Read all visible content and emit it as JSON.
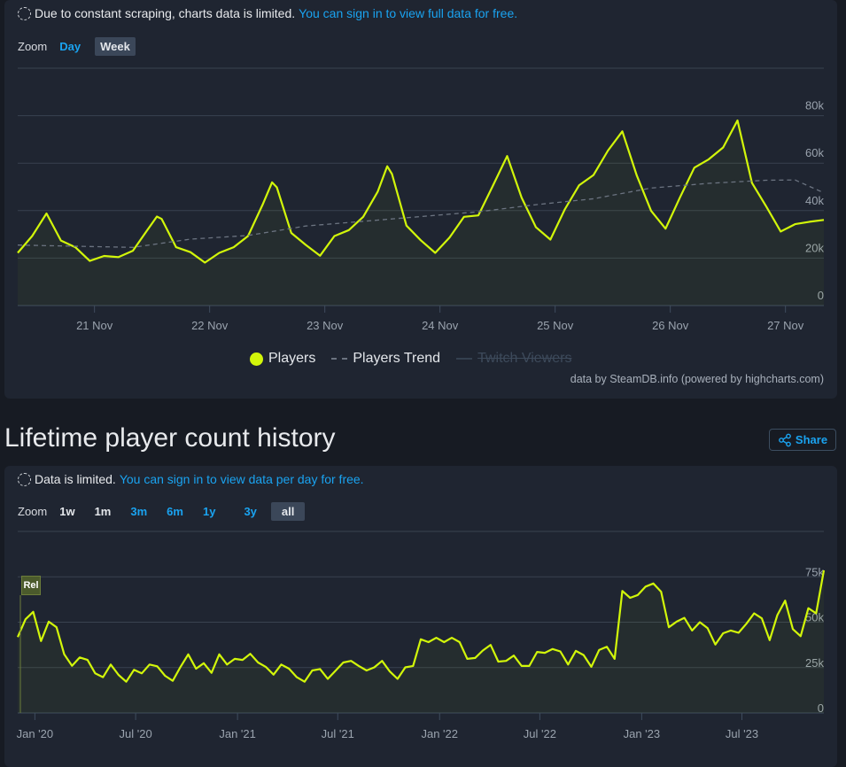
{
  "recent_panel": {
    "notice_text": "Due to constant scraping, charts data is limited.",
    "notice_link": "You can sign in to view full data for free.",
    "zoom_label": "Zoom",
    "zoom_options": [
      "Day",
      "Week"
    ],
    "zoom_selected": "Week",
    "legend": {
      "players": "Players",
      "trend": "Players Trend",
      "twitch": "Twitch Viewers"
    },
    "credit": "data by SteamDB.info (powered by highcharts.com)"
  },
  "lifetime_section": {
    "title": "Lifetime player count history",
    "share_label": "Share",
    "notice_text": "Data is limited.",
    "notice_link": "You can sign in to view data per day for free.",
    "zoom_label": "Zoom",
    "zoom_options": [
      "1w",
      "1m",
      "3m",
      "6m",
      "1y",
      "3y",
      "all"
    ],
    "zoom_selected": "all",
    "flag_label": "Rel"
  },
  "colors": {
    "players": "#d2f60a",
    "trend": "#6b7380",
    "twitch_disabled": "#3d4a5b",
    "link": "#1aa3f0",
    "background": "#171b23",
    "panel": "#1f2531"
  },
  "chart_data": [
    {
      "type": "line",
      "xlabel": "",
      "ylabel": "",
      "x_ticks": [
        "21 Nov",
        "22 Nov",
        "23 Nov",
        "24 Nov",
        "25 Nov",
        "26 Nov",
        "27 Nov"
      ],
      "y_ticks": [
        "0",
        "20k",
        "40k",
        "60k",
        "80k"
      ],
      "ylim": [
        0,
        100000
      ],
      "grid": true,
      "legend_position": "bottom",
      "series": [
        {
          "name": "Players",
          "style": "solid",
          "x": [
            "20 Nov 08:00",
            "20 Nov 11:00",
            "20 Nov 14:00",
            "20 Nov 17:00",
            "20 Nov 20:00",
            "20 Nov 23:00",
            "21 Nov 02:00",
            "21 Nov 05:00",
            "21 Nov 08:00",
            "21 Nov 11:00",
            "21 Nov 13:00",
            "21 Nov 14:00",
            "21 Nov 17:00",
            "21 Nov 20:00",
            "21 Nov 23:00",
            "22 Nov 02:00",
            "22 Nov 05:00",
            "22 Nov 08:00",
            "22 Nov 11:00",
            "22 Nov 13:00",
            "22 Nov 14:00",
            "22 Nov 17:00",
            "22 Nov 20:00",
            "22 Nov 23:00",
            "23 Nov 02:00",
            "23 Nov 05:00",
            "23 Nov 08:00",
            "23 Nov 11:00",
            "23 Nov 13:00",
            "23 Nov 14:00",
            "23 Nov 17:00",
            "23 Nov 20:00",
            "23 Nov 23:00",
            "24 Nov 02:00",
            "24 Nov 05:00",
            "24 Nov 08:00",
            "24 Nov 11:00",
            "24 Nov 14:00",
            "24 Nov 17:00",
            "24 Nov 20:00",
            "24 Nov 23:00",
            "25 Nov 02:00",
            "25 Nov 05:00",
            "25 Nov 08:00",
            "25 Nov 11:00",
            "25 Nov 14:00",
            "25 Nov 17:00",
            "25 Nov 20:00",
            "25 Nov 23:00",
            "26 Nov 02:00",
            "26 Nov 05:00",
            "26 Nov 08:00",
            "26 Nov 11:00",
            "26 Nov 14:00",
            "26 Nov 17:00",
            "26 Nov 20:00",
            "26 Nov 23:00",
            "27 Nov 02:00",
            "27 Nov 05:00",
            "27 Nov 08:00"
          ],
          "y": [
            22200,
            29300,
            38800,
            27400,
            24600,
            18800,
            20900,
            20400,
            23100,
            31800,
            37500,
            36500,
            24600,
            22500,
            18100,
            22200,
            24600,
            29300,
            42400,
            51900,
            49800,
            30600,
            25600,
            21000,
            29300,
            31800,
            37400,
            47900,
            58700,
            55400,
            33700,
            27500,
            22200,
            28700,
            37400,
            38000,
            50400,
            63000,
            45500,
            33000,
            27800,
            40500,
            50700,
            55000,
            65300,
            73400,
            54800,
            39900,
            32400,
            45500,
            58100,
            61600,
            66600,
            78000,
            51700,
            41700,
            31200,
            34300,
            35300,
            36100
          ]
        },
        {
          "name": "Players Trend",
          "style": "dashed",
          "x": [
            "20 Nov 08:00",
            "20 Nov 20:00",
            "21 Nov 08:00",
            "21 Nov 20:00",
            "22 Nov 08:00",
            "22 Nov 20:00",
            "23 Nov 08:00",
            "23 Nov 20:00",
            "24 Nov 08:00",
            "24 Nov 20:00",
            "25 Nov 08:00",
            "25 Nov 20:00",
            "26 Nov 08:00",
            "26 Nov 20:00",
            "27 Nov 02:00",
            "27 Nov 08:00"
          ],
          "y": [
            25500,
            25000,
            24500,
            28000,
            29500,
            33500,
            35500,
            37500,
            39500,
            42500,
            45000,
            49500,
            51500,
            52800,
            52900,
            47500
          ]
        },
        {
          "name": "Twitch Viewers",
          "style": "hidden",
          "x": [],
          "y": []
        }
      ]
    },
    {
      "type": "line",
      "xlabel": "",
      "ylabel": "",
      "x_ticks": [
        "Jan '20",
        "Jul '20",
        "Jan '21",
        "Jul '21",
        "Jan '22",
        "Jul '22",
        "Jan '23",
        "Jul '23"
      ],
      "y_ticks": [
        "0",
        "25k",
        "50k",
        "75k"
      ],
      "ylim": [
        0,
        100000
      ],
      "grid": true,
      "annotations": [
        {
          "label": "Rel",
          "x": "2019-12-01"
        }
      ],
      "series": [
        {
          "name": "Players",
          "x": [
            "2019-12-01",
            "2019-12-15",
            "2019-12-29",
            "2020-01-12",
            "2020-01-26",
            "2020-02-09",
            "2020-02-23",
            "2020-03-08",
            "2020-03-22",
            "2020-04-05",
            "2020-04-19",
            "2020-05-03",
            "2020-05-17",
            "2020-05-31",
            "2020-06-14",
            "2020-06-28",
            "2020-07-12",
            "2020-07-26",
            "2020-08-09",
            "2020-08-23",
            "2020-09-06",
            "2020-09-20",
            "2020-10-04",
            "2020-10-18",
            "2020-11-01",
            "2020-11-15",
            "2020-11-29",
            "2020-12-13",
            "2020-12-27",
            "2021-01-10",
            "2021-01-24",
            "2021-02-07",
            "2021-02-21",
            "2021-03-07",
            "2021-03-21",
            "2021-04-04",
            "2021-04-18",
            "2021-05-02",
            "2021-05-16",
            "2021-05-30",
            "2021-06-13",
            "2021-06-27",
            "2021-07-11",
            "2021-07-25",
            "2021-08-08",
            "2021-08-22",
            "2021-09-05",
            "2021-09-19",
            "2021-10-03",
            "2021-10-17",
            "2021-10-31",
            "2021-11-14",
            "2021-11-28",
            "2021-12-12",
            "2021-12-26",
            "2022-01-09",
            "2022-01-23",
            "2022-02-06",
            "2022-02-20",
            "2022-03-06",
            "2022-03-20",
            "2022-04-03",
            "2022-04-17",
            "2022-05-01",
            "2022-05-15",
            "2022-05-29",
            "2022-06-12",
            "2022-06-26",
            "2022-07-10",
            "2022-07-24",
            "2022-08-07",
            "2022-08-21",
            "2022-09-04",
            "2022-09-18",
            "2022-10-02",
            "2022-10-16",
            "2022-10-30",
            "2022-11-13",
            "2022-11-27",
            "2022-12-11",
            "2022-12-25",
            "2023-01-08",
            "2023-01-22",
            "2023-02-05",
            "2023-02-19",
            "2023-03-05",
            "2023-03-19",
            "2023-04-02",
            "2023-04-16",
            "2023-04-30",
            "2023-05-14",
            "2023-05-28",
            "2023-06-11",
            "2023-06-25",
            "2023-07-09",
            "2023-07-23",
            "2023-08-06",
            "2023-08-20",
            "2023-09-03",
            "2023-09-17",
            "2023-10-01",
            "2023-10-15",
            "2023-10-29",
            "2023-11-12",
            "2023-11-26"
          ],
          "y": [
            41800,
            51600,
            55700,
            39600,
            50300,
            47200,
            32300,
            26000,
            30600,
            29200,
            21800,
            19700,
            26700,
            21000,
            17200,
            23800,
            21800,
            26700,
            25700,
            20500,
            17700,
            25400,
            32300,
            24400,
            27400,
            22100,
            32300,
            26700,
            29800,
            29200,
            32600,
            27800,
            25400,
            21100,
            26700,
            24400,
            19700,
            17200,
            23400,
            24200,
            18800,
            23300,
            27800,
            28700,
            25900,
            23400,
            25100,
            28700,
            22900,
            18800,
            25100,
            25900,
            40600,
            39000,
            41400,
            39000,
            41400,
            39000,
            29800,
            30300,
            34400,
            37500,
            28300,
            28700,
            31600,
            25900,
            25900,
            33600,
            33100,
            35200,
            33900,
            26700,
            34200,
            31900,
            25400,
            34700,
            36500,
            29800,
            67200,
            63400,
            65000,
            69600,
            71300,
            66800,
            47200,
            50300,
            52400,
            45400,
            50000,
            46700,
            37700,
            43900,
            45400,
            44200,
            49100,
            54900,
            52100,
            40100,
            53900,
            61900,
            46200,
            42300,
            57700,
            54900,
            78600
          ]
        }
      ]
    }
  ]
}
